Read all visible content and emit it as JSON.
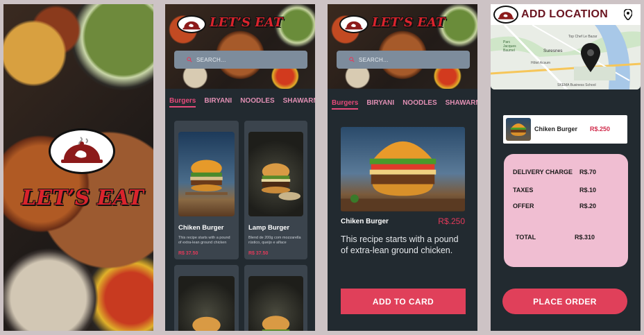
{
  "splash": {
    "brand": "LET’S EAT"
  },
  "menu": {
    "brand": "LET’S EAT",
    "search_placeholder": "SEARCH...",
    "tabs": [
      "Burgers",
      "BIRYANI",
      "NOODLES",
      "SHAWARMA"
    ],
    "active_tab": "Burgers",
    "cards": [
      {
        "name": "Chiken Burger",
        "desc": "This recipe starts with a pound of extra-lean ground chicken",
        "price": "R$ 37.50"
      },
      {
        "name": "Lamp Burger",
        "desc": "Blend de 200g com mozzarella rústico, queijo e alface",
        "price": "R$ 37.50"
      }
    ]
  },
  "detail": {
    "brand": "LET’S EAT",
    "search_placeholder": "SEARCH...",
    "tabs": [
      "Burgers",
      "BIRYANI",
      "NOODLES",
      "SHAWARMA"
    ],
    "name": "Chiken Burger",
    "price": "R$.250",
    "description": "This recipe starts with a pound of extra-lean ground chicken.",
    "button": "ADD TO CARD"
  },
  "checkout": {
    "title": "ADD LOCATION",
    "map_labels": [
      "Top Chef Le Bazar",
      "Parc Jacques Baumel",
      "Suresnes",
      "Hôtel Acsum",
      "SKEMA Business School"
    ],
    "item": {
      "name": "Chiken Burger",
      "price": "R$.250"
    },
    "summary": [
      {
        "label": "DELIVERY CHARGE",
        "value": "R$.70"
      },
      {
        "label": "TAXES",
        "value": "R$.10"
      },
      {
        "label": "OFFER",
        "value": "R$.20"
      },
      {
        "label": "TOTAL",
        "value": "R$.310"
      }
    ],
    "button": "PLACE ORDER"
  },
  "colors": {
    "accent": "#e0405a",
    "brand_red": "#d9232c",
    "panel": "#222a30",
    "pink": "#f0bed2",
    "tab": "#e08fb3"
  },
  "icons": [
    "chef-cloche-logo-icon",
    "search-icon",
    "location-pin-icon",
    "map-marker-icon"
  ]
}
